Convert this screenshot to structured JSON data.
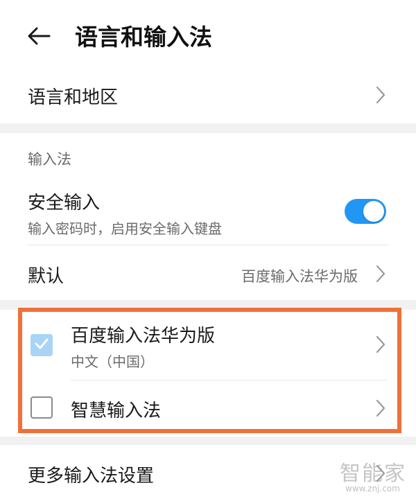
{
  "header": {
    "back_icon": "arrow-left-icon",
    "title": "语言和输入法"
  },
  "language_region": {
    "label": "语言和地区",
    "chevron_icon": "chevron-right-icon"
  },
  "input_section": {
    "label": "输入法",
    "secure_input": {
      "title": "安全输入",
      "subtitle": "输入密码时，启用安全输入键盘",
      "enabled": true,
      "toggle_color": "#2196f3"
    },
    "default": {
      "label": "默认",
      "value": "百度输入法华为版",
      "chevron_icon": "chevron-right-icon"
    }
  },
  "input_methods": [
    {
      "name": "百度输入法华为版",
      "subtitle": "中文（中国）",
      "checked": true,
      "checkbox_color": "#a9d4f5"
    },
    {
      "name": "智慧输入法",
      "checked": false
    }
  ],
  "more_settings": {
    "label": "更多输入法设置",
    "chevron_icon": "chevron-right-icon"
  },
  "highlight_color": "#f0703a",
  "watermark": {
    "brand": "智能家",
    "url": "www.znj.com"
  }
}
